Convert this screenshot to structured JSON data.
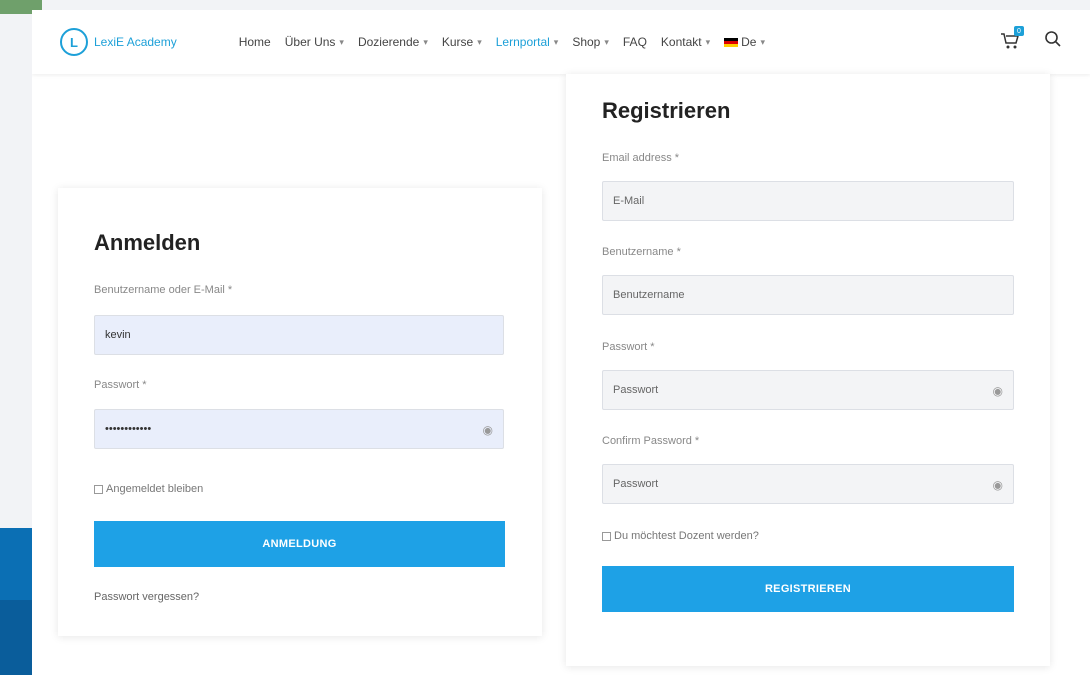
{
  "header": {
    "logo_text": "LexiE Academy",
    "nav": [
      {
        "label": "Home",
        "dropdown": false,
        "active": false
      },
      {
        "label": "Über Uns",
        "dropdown": true,
        "active": false
      },
      {
        "label": "Dozierende",
        "dropdown": true,
        "active": false
      },
      {
        "label": "Kurse",
        "dropdown": true,
        "active": false
      },
      {
        "label": "Lernportal",
        "dropdown": true,
        "active": true
      },
      {
        "label": "Shop",
        "dropdown": true,
        "active": false
      },
      {
        "label": "FAQ",
        "dropdown": false,
        "active": false
      },
      {
        "label": "Kontakt",
        "dropdown": true,
        "active": false
      },
      {
        "label": "De",
        "dropdown": true,
        "active": false,
        "flag": "de"
      }
    ],
    "cart_badge": "0",
    "cart_icon": "cart-icon",
    "search_icon": "search-icon"
  },
  "login": {
    "title": "Anmelden",
    "username_label": "Benutzername oder E-Mail *",
    "username_value": "kevin",
    "password_label": "Passwort *",
    "password_value": "••••••••••••",
    "remember_label": "Angemeldet bleiben",
    "submit_label": "ANMELDUNG",
    "forgot_label": "Passwort vergessen?"
  },
  "register": {
    "title": "Registrieren",
    "email_label": "Email address *",
    "email_placeholder": "E-Mail",
    "username_label": "Benutzername *",
    "username_placeholder": "Benutzername",
    "password_label": "Passwort *",
    "password_placeholder": "Passwort",
    "confirm_label": "Confirm Password *",
    "confirm_placeholder": "Passwort",
    "lecturer_label": "Du möchtest Dozent werden?",
    "submit_label": "REGISTRIEREN"
  },
  "colors": {
    "accent": "#1ea1e6",
    "brand": "#1da0d8",
    "field_filled": "#e9eefb",
    "field_empty": "#f3f4f6"
  }
}
